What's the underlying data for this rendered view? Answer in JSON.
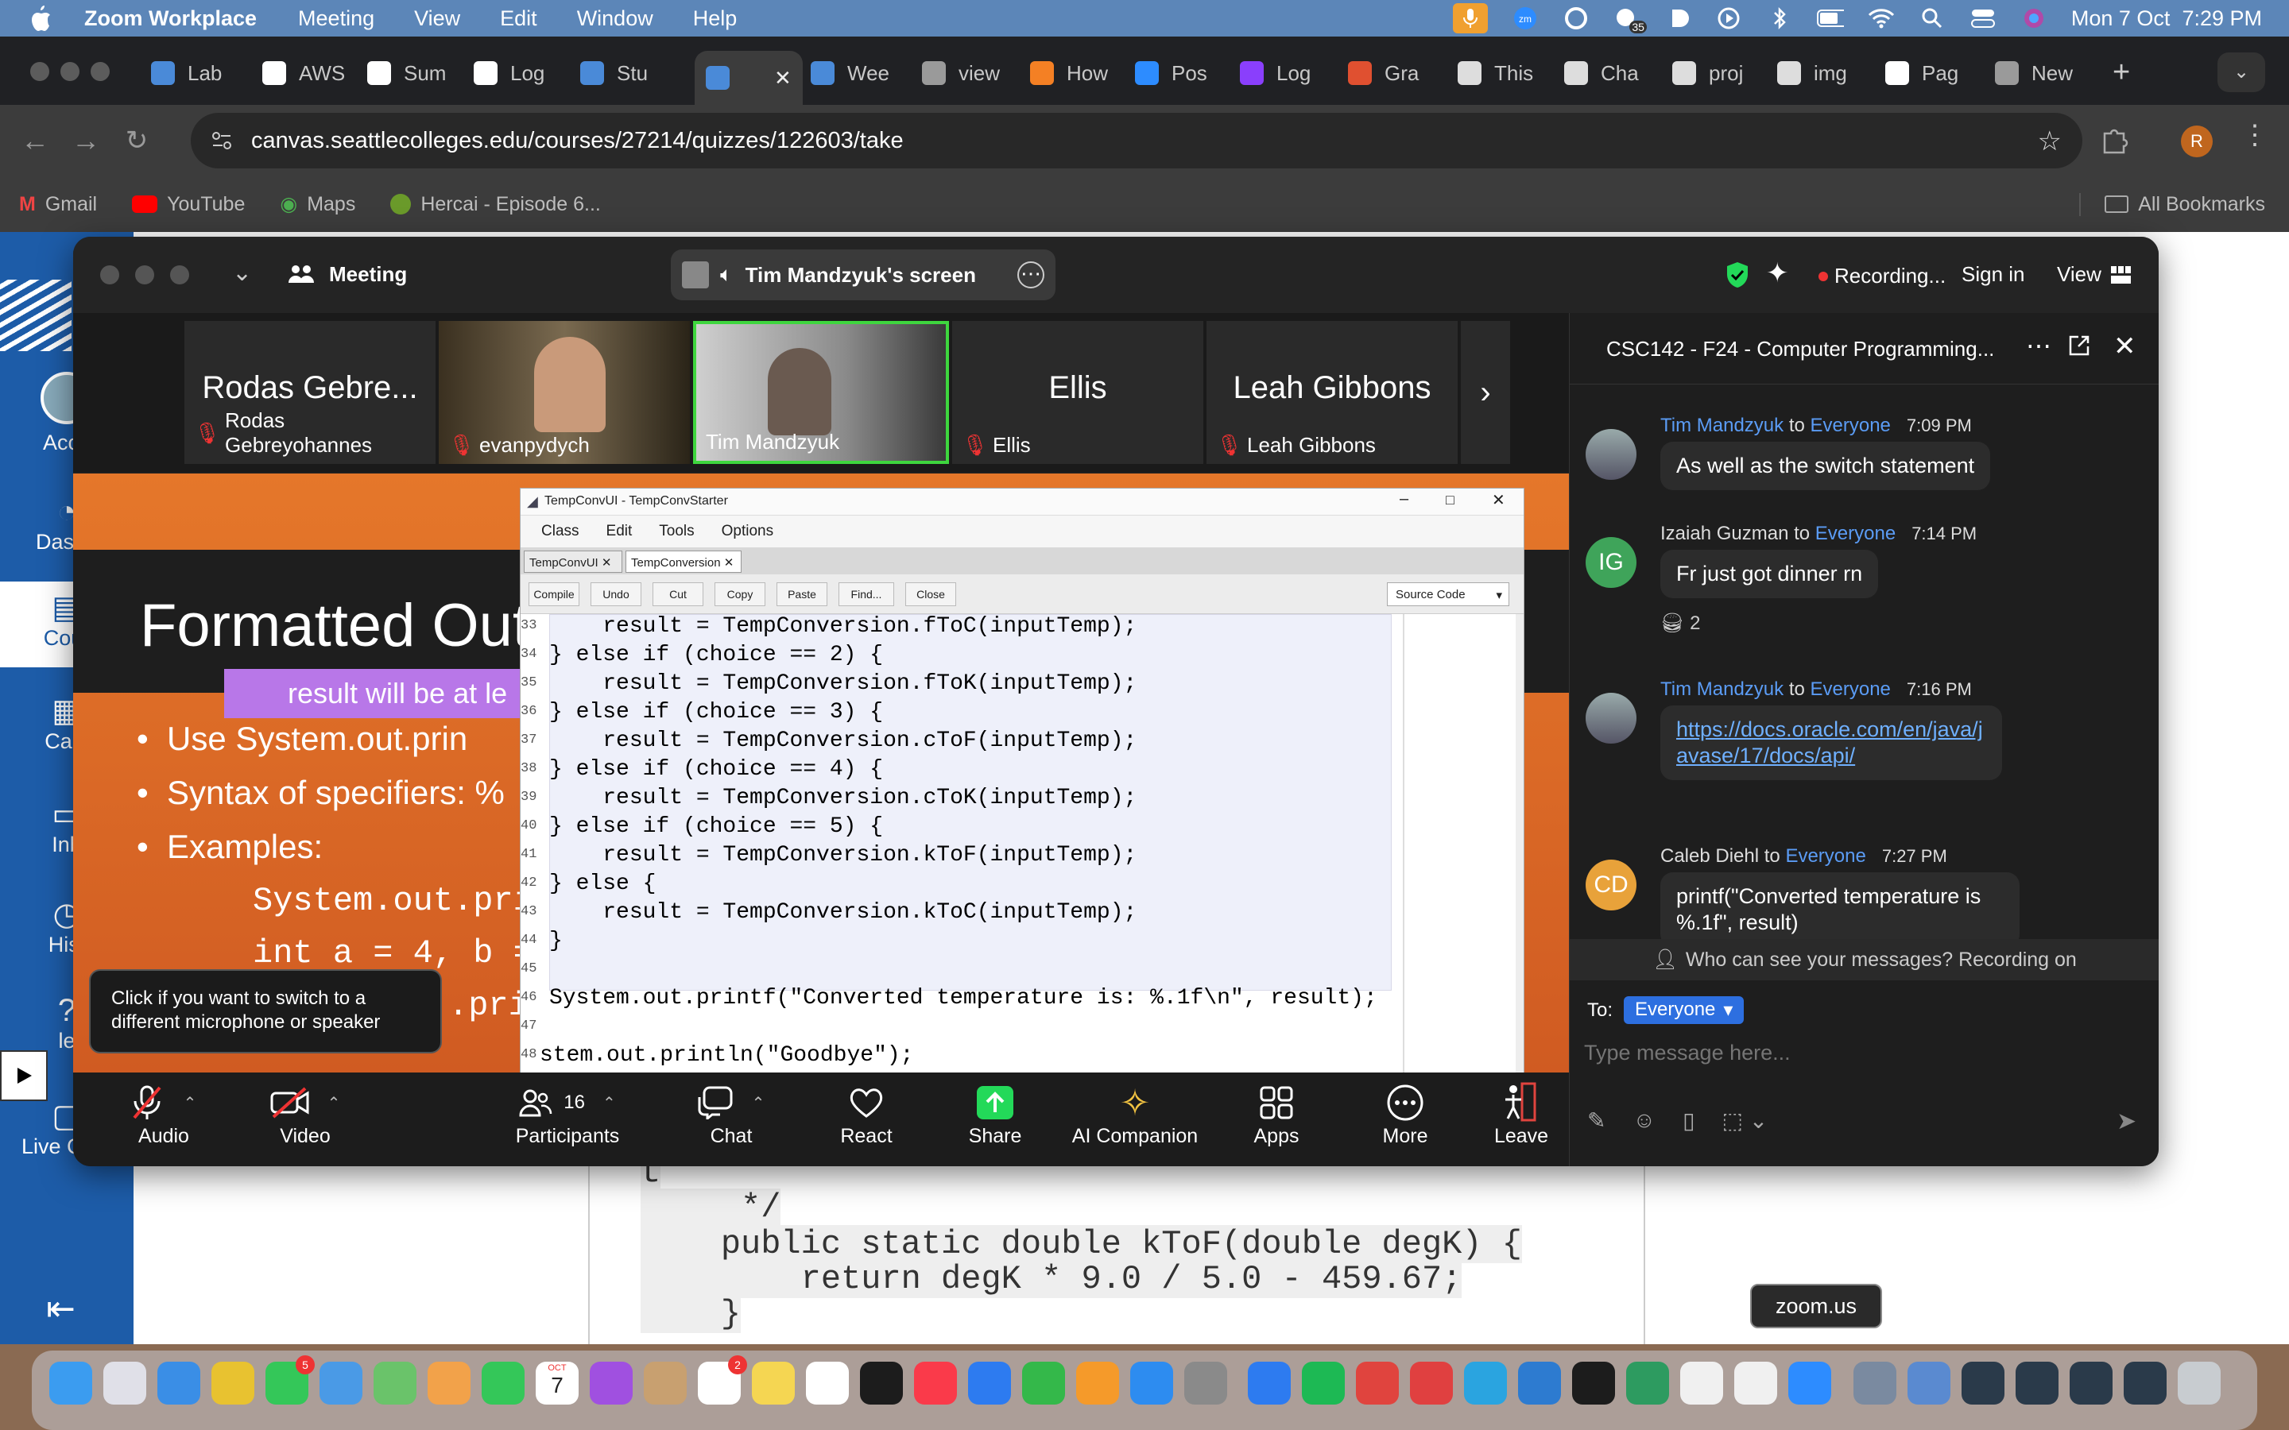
{
  "menubar": {
    "app": "Zoom Workplace",
    "items": [
      "Meeting",
      "View",
      "Edit",
      "Window",
      "Help"
    ],
    "clock": "Mon 7 Oct  7:29 PM",
    "notification_count": "35"
  },
  "browser": {
    "tabs": [
      {
        "label": "Lab",
        "icon": "chart-icon",
        "color": "#4a8ad8"
      },
      {
        "label": "AWS",
        "icon": "amazon-icon",
        "color": "#ffffff"
      },
      {
        "label": "Sum",
        "icon": "amazon-icon",
        "color": "#ffffff"
      },
      {
        "label": "Log",
        "icon": "amazon-icon",
        "color": "#ffffff"
      },
      {
        "label": "Stu",
        "icon": "chart-icon",
        "color": "#4a8ad8"
      },
      {
        "label": "",
        "icon": "chart-icon",
        "color": "#4a8ad8"
      },
      {
        "label": "Wee",
        "icon": "chart-icon",
        "color": "#4a8ad8"
      },
      {
        "label": "view",
        "icon": "globe-icon",
        "color": "#9a9a9a"
      },
      {
        "label": "How",
        "icon": "stack-icon",
        "color": "#f48024"
      },
      {
        "label": "Pos",
        "icon": "zoom-icon",
        "color": "#2d8cff"
      },
      {
        "label": "Log",
        "icon": "heroku-icon",
        "color": "#8a3ffc"
      },
      {
        "label": "Gra",
        "icon": "gradescope-icon",
        "color": "#e05030"
      },
      {
        "label": "This",
        "icon": "dots-icon",
        "color": "#dddddd"
      },
      {
        "label": "Cha",
        "icon": "openai-icon",
        "color": "#dddddd"
      },
      {
        "label": "proj",
        "icon": "search-icon",
        "color": "#dddddd"
      },
      {
        "label": "img",
        "icon": "search-icon",
        "color": "#dddddd"
      },
      {
        "label": "Pag",
        "icon": "github-icon",
        "color": "#ffffff"
      },
      {
        "label": "New",
        "icon": "globe-icon",
        "color": "#9a9a9a"
      }
    ],
    "url": "canvas.seattlecolleges.edu/courses/27214/quizzes/122603/take",
    "profile_initial": "R",
    "bookmarks": [
      "Gmail",
      "YouTube",
      "Maps",
      "Hercai - Episode 6..."
    ],
    "all_bookmarks": "All Bookmarks"
  },
  "canvas": {
    "nav": [
      "Acco",
      "Dashb",
      "Cour",
      "Cale",
      "Inb",
      "Hist",
      "le",
      "Live Chat"
    ],
    "code_bg": [
      "t",
      "     */",
      "    public static double kToF(double degK) {",
      "        return degK * 9.0 / 5.0 - 459.67;",
      "    }"
    ]
  },
  "zoom": {
    "title": "Meeting",
    "screen_label": "Tim Mandzyuk's screen",
    "recording": "Recording...",
    "sign_in": "Sign in",
    "view": "View",
    "participants": [
      {
        "short": "Rodas Gebre...",
        "name": "Rodas Gebreyohannes",
        "muted": true,
        "video": false
      },
      {
        "short": "",
        "name": "evanpydych",
        "muted": true,
        "video": true
      },
      {
        "short": "",
        "name": "Tim Mandzyuk",
        "muted": false,
        "video": true
      },
      {
        "short": "Ellis",
        "name": "Ellis",
        "muted": true,
        "video": false
      },
      {
        "short": "Leah Gibbons",
        "name": "Leah Gibbons",
        "muted": true,
        "video": false
      }
    ],
    "slide": {
      "title": "Formatted Out",
      "banner": "result will be at le",
      "bullets": [
        "Use System.out.prin",
        "Syntax of specifiers:  %",
        "Examples:"
      ],
      "examples": [
        "System.out.pri",
        "int a = 4, b =",
        ".pri"
      ]
    },
    "ide": {
      "title": "TempConvUI - TempConvStarter",
      "menu": [
        "Class",
        "Edit",
        "Tools",
        "Options"
      ],
      "tabs": [
        "TempConvUI",
        "TempConversion"
      ],
      "buttons": [
        "Compile",
        "Undo",
        "Cut",
        "Copy",
        "Paste",
        "Find...",
        "Close"
      ],
      "view_select": "Source Code",
      "lines": [
        {
          "n": "33",
          "code": "    result = TempConversion.fToC(inputTemp);"
        },
        {
          "n": "34",
          "code": "} else if (choice == 2) {"
        },
        {
          "n": "35",
          "code": "    result = TempConversion.fToK(inputTemp);"
        },
        {
          "n": "36",
          "code": "} else if (choice == 3) {"
        },
        {
          "n": "37",
          "code": "    result = TempConversion.cToF(inputTemp);"
        },
        {
          "n": "38",
          "code": "} else if (choice == 4) {"
        },
        {
          "n": "39",
          "code": "    result = TempConversion.cToK(inputTemp);"
        },
        {
          "n": "40",
          "code": "} else if (choice == 5) {"
        },
        {
          "n": "41",
          "code": "    result = TempConversion.kToF(inputTemp);"
        },
        {
          "n": "42",
          "code": "} else {"
        },
        {
          "n": "43",
          "code": "    result = TempConversion.kToC(inputTemp);"
        },
        {
          "n": "44",
          "code": "}"
        },
        {
          "n": "45",
          "code": ""
        },
        {
          "n": "46",
          "code": "System.out.printf(\"Converted temperature is: %.1f\\n\", result);"
        },
        {
          "n": "47",
          "code": ""
        },
        {
          "n": "48",
          "code": "stem.out.println(\"Goodbye\");"
        }
      ]
    },
    "tooltip": "Click if you want to switch to a different microphone or speaker",
    "controls": {
      "audio": "Audio",
      "video": "Video",
      "participants": "Participants",
      "participants_count": "16",
      "chat": "Chat",
      "react": "React",
      "share": "Share",
      "ai": "AI Companion",
      "apps": "Apps",
      "more": "More",
      "leave": "Leave"
    },
    "chat": {
      "title": "CSC142 - F24 - Computer Programming...",
      "messages": [
        {
          "from": "Tim Mandzyuk",
          "to": "to",
          "target": "Everyone",
          "time": "7:09 PM",
          "text": "As well as the switch statement",
          "avatar": "photo"
        },
        {
          "from": "Izaiah Guzman",
          "to": "to",
          "target": "Everyone",
          "time": "7:14 PM",
          "text": "Fr just got dinner rn",
          "avatar": "IG",
          "reaction": "2"
        },
        {
          "from": "Tim Mandzyuk",
          "to": "to",
          "target": "Everyone",
          "time": "7:16 PM",
          "text": "https://docs.oracle.com/en/java/javase/17/docs/api/",
          "avatar": "photo"
        },
        {
          "from": "Caleb Diehl",
          "to": "to",
          "target": "Everyone",
          "time": "7:27 PM",
          "text": "printf(\"Converted temperature is %.1f\", result)",
          "avatar": "CD"
        }
      ],
      "privacy": "Who can see your messages? Recording on",
      "to_label": "To:",
      "to_value": "Everyone",
      "placeholder": "Type message here..."
    }
  },
  "dock": {
    "tooltip": "zoom.us",
    "calendar_month": "OCT",
    "calendar_day": "7",
    "facetime_badge": "5",
    "reminders_badge": "2"
  },
  "colors": {
    "menubar": "#5c86b8",
    "zoom_green": "#23d959",
    "link": "#5b9cf5",
    "leave_red": "#e0443e",
    "slide_orange": "#e5772a"
  }
}
